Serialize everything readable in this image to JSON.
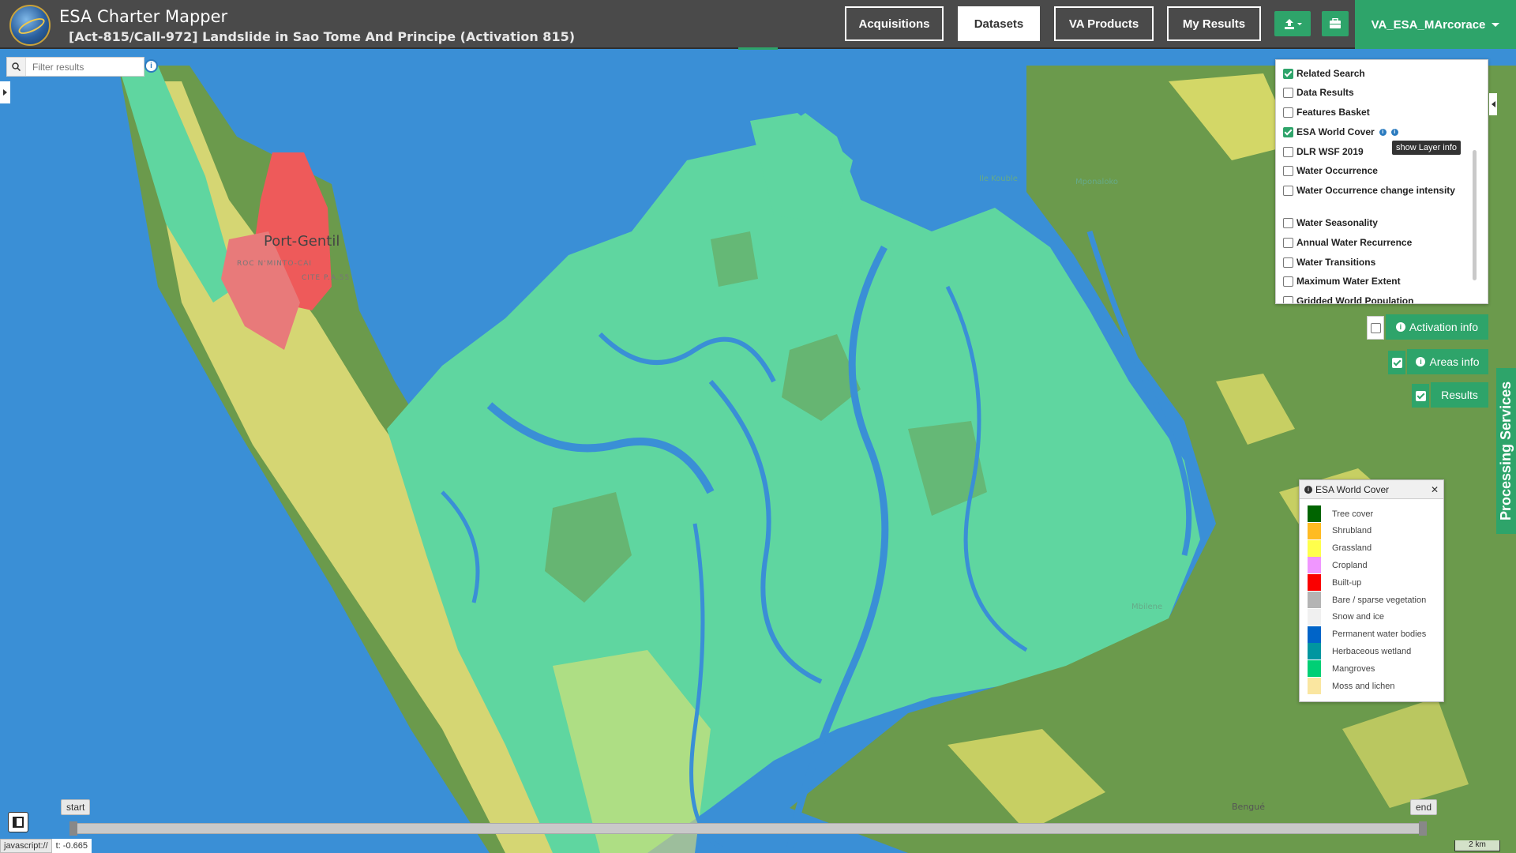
{
  "header": {
    "app_title": "ESA Charter Mapper",
    "activation_title": "[Act-815/Call-972] Landslide in Sao Tome And Principe (Activation 815)",
    "nav": [
      "Acquisitions",
      "Datasets",
      "VA Products",
      "My Results"
    ],
    "active_nav": "Datasets",
    "user": "VA_ESA_MArcorace"
  },
  "filter": {
    "placeholder": "Filter results"
  },
  "layers": [
    {
      "label": "Related Search",
      "checked": true
    },
    {
      "label": "Data Results",
      "checked": false
    },
    {
      "label": "Features Basket",
      "checked": false
    },
    {
      "label": "ESA World Cover",
      "checked": true
    },
    {
      "label": "DLR WSF 2019",
      "checked": false
    },
    {
      "label": "Water Occurrence",
      "checked": false
    },
    {
      "label": "Water Occurrence change intensity",
      "checked": false
    },
    {
      "label": "Water Seasonality",
      "checked": false
    },
    {
      "label": "Annual Water Recurrence",
      "checked": false
    },
    {
      "label": "Water Transitions",
      "checked": false
    },
    {
      "label": "Maximum Water Extent",
      "checked": false
    },
    {
      "label": "Gridded World Population",
      "checked": false
    }
  ],
  "tooltip": "show Layer info",
  "buttons": {
    "activation_info": "Activation info",
    "areas_info": "Areas info",
    "results": "Results",
    "processing_services": "Processing Services"
  },
  "legend": {
    "title": "ESA World Cover",
    "items": [
      {
        "label": "Tree cover",
        "color": "#006400"
      },
      {
        "label": "Shrubland",
        "color": "#ffbb22"
      },
      {
        "label": "Grassland",
        "color": "#ffff4c"
      },
      {
        "label": "Cropland",
        "color": "#f096ff"
      },
      {
        "label": "Built-up",
        "color": "#fa0000"
      },
      {
        "label": "Bare / sparse vegetation",
        "color": "#b4b4b4"
      },
      {
        "label": "Snow and ice",
        "color": "#f0f0f0"
      },
      {
        "label": "Permanent water bodies",
        "color": "#0064c8"
      },
      {
        "label": "Herbaceous wetland",
        "color": "#0096a0"
      },
      {
        "label": "Mangroves",
        "color": "#00cf75"
      },
      {
        "label": "Moss and lichen",
        "color": "#fae6a0"
      }
    ]
  },
  "map_labels": {
    "city": "Port-Gentil",
    "place1": "Ile Kouble",
    "place2": "Mponaloko",
    "place3": "Mbilene",
    "place4": "Bengué",
    "quarter1": "ROC N'MINTO-CAI",
    "quarter2": "CITE P.A.55"
  },
  "timeline": {
    "start": "start",
    "end": "end"
  },
  "status": {
    "url": "javascript://",
    "coord": "t: -0.665"
  },
  "scale": "2 km",
  "colors": {
    "accent": "#2ea46a",
    "topbar": "#4a4a4a",
    "water": "#3a8fd6",
    "mangrove": "#5fd6a0",
    "land": "#6b9a4c"
  }
}
